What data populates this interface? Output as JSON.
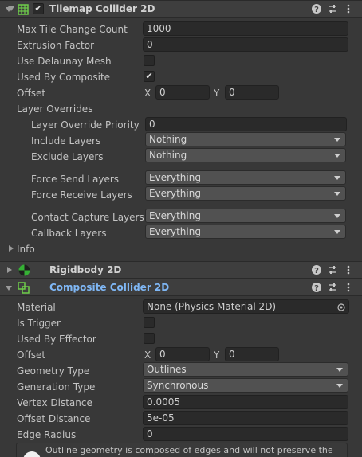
{
  "tilemap_collider": {
    "title": "Tilemap Collider 2D",
    "enabled_check": "✔",
    "fields": {
      "max_tile_change_count": {
        "label": "Max Tile Change Count",
        "value": "1000"
      },
      "extrusion_factor": {
        "label": "Extrusion Factor",
        "value": "0"
      },
      "use_delaunay_mesh": {
        "label": "Use Delaunay Mesh",
        "checked": ""
      },
      "used_by_composite": {
        "label": "Used By Composite",
        "checked": "✔"
      },
      "offset": {
        "label": "Offset",
        "x_label": "X",
        "x": "0",
        "y_label": "Y",
        "y": "0"
      }
    },
    "layer_overrides": {
      "label": "Layer Overrides",
      "priority": {
        "label": "Layer Override Priority",
        "value": "0"
      },
      "include": {
        "label": "Include Layers",
        "value": "Nothing"
      },
      "exclude": {
        "label": "Exclude Layers",
        "value": "Nothing"
      },
      "force_send": {
        "label": "Force Send Layers",
        "value": "Everything"
      },
      "force_receive": {
        "label": "Force Receive Layers",
        "value": "Everything"
      },
      "contact_capture": {
        "label": "Contact Capture Layers",
        "value": "Everything"
      },
      "callback": {
        "label": "Callback Layers",
        "value": "Everything"
      }
    },
    "info": {
      "label": "Info"
    }
  },
  "rigidbody": {
    "title": "Rigidbody 2D"
  },
  "composite_collider": {
    "title": "Composite Collider 2D",
    "fields": {
      "material": {
        "label": "Material",
        "value": "None (Physics Material 2D)"
      },
      "is_trigger": {
        "label": "Is Trigger",
        "checked": ""
      },
      "used_by_effector": {
        "label": "Used By Effector",
        "checked": ""
      },
      "offset": {
        "label": "Offset",
        "x_label": "X",
        "x": "0",
        "y_label": "Y",
        "y": "0"
      },
      "geometry_type": {
        "label": "Geometry Type",
        "value": "Outlines"
      },
      "generation_type": {
        "label": "Generation Type",
        "value": "Synchronous"
      },
      "vertex_distance": {
        "label": "Vertex Distance",
        "value": "0.0005"
      },
      "offset_distance": {
        "label": "Offset Distance",
        "value": "5e-05"
      },
      "edge_radius": {
        "label": "Edge Radius",
        "value": "0"
      }
    },
    "help_text": "Outline geometry is composed of edges and will not preserve the original"
  },
  "colors": {
    "panel_bg": "#383838",
    "header_bg": "#3e3e3e",
    "field_bg": "#2a2a2a",
    "dropdown_bg": "#515151",
    "composite_title": "#7fb7f5",
    "rigidbody_icon_green": "#35b135"
  },
  "icons": {
    "tilemap": "grid-icon",
    "rigidbody": "physics-ball-icon",
    "composite": "composite-shape-icon",
    "help": "help-icon",
    "presets": "sliders-icon",
    "menu": "kebab-menu-icon",
    "object_picker": "object-picker-icon",
    "info": "info-icon"
  }
}
